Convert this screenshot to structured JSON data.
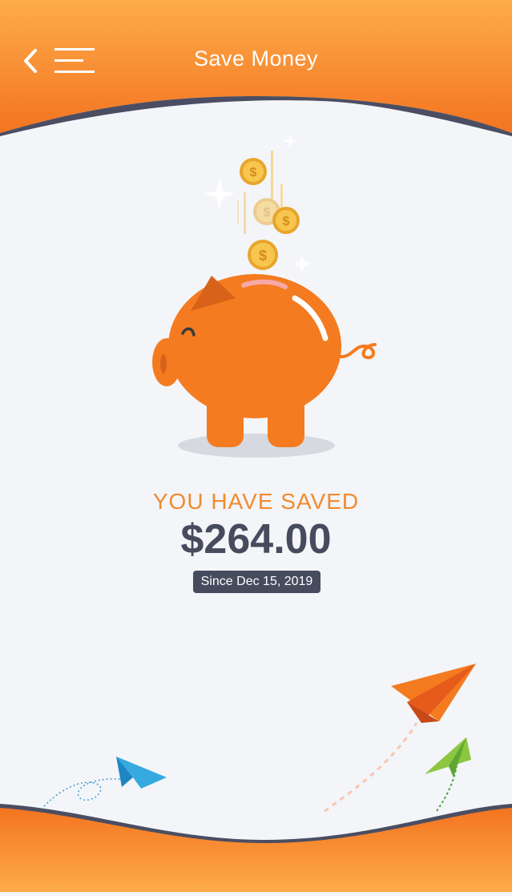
{
  "header": {
    "title": "Save Money",
    "back_icon": "chevron-left-icon",
    "menu_icon": "hamburger-menu-icon"
  },
  "savings": {
    "label": "YOU HAVE SAVED",
    "amount": "$264.00",
    "since": "Since Dec 15, 2019"
  },
  "colors": {
    "accent_orange": "#f47b20",
    "dark_navy": "#474b5e",
    "label_orange": "#f28a2e",
    "background": "#f3f5f8"
  }
}
